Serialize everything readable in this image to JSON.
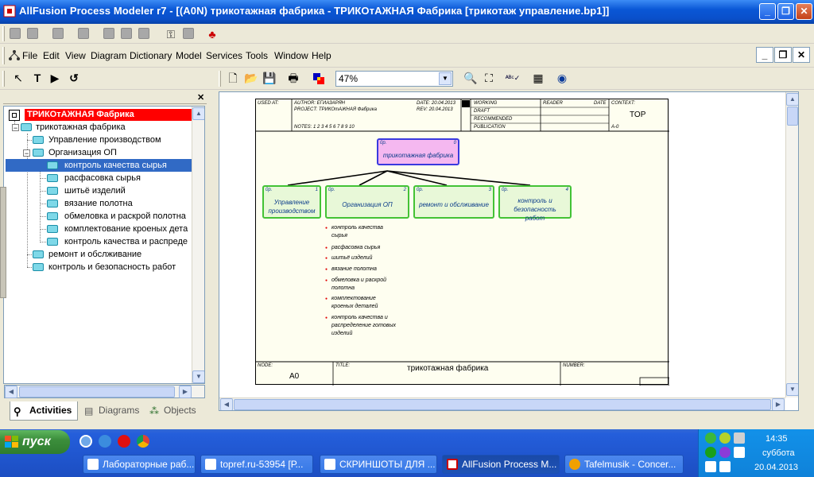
{
  "window": {
    "title": "AllFusion Process Modeler r7 - [(A0N) трикотажная фабрика - ТРИКОтАЖНАЯ Фабрика  [трикотаж управление.bp1]]",
    "minimize": "_",
    "restore": "❐",
    "close": "✕"
  },
  "menu": {
    "items": [
      "File",
      "Edit",
      "View",
      "Diagram",
      "Dictionary",
      "Model",
      "Services",
      "Tools",
      "Window",
      "Help"
    ]
  },
  "toolbar": {
    "zoom": "47%",
    "icons": [
      "new-icon",
      "open-icon",
      "save-icon",
      "print-icon",
      "color-icon",
      "zoom-in-icon",
      "zoom-fit-icon",
      "spellcheck-icon",
      "model-explorer-icon",
      "navigator-icon"
    ]
  },
  "tool_palette": {
    "icons": [
      "pointer-icon",
      "text-tool-icon",
      "arrow-tool-icon",
      "undo-icon"
    ]
  },
  "model_explorer": {
    "root": "ТРИКОтАЖНАЯ Фабрика",
    "nodes": [
      {
        "label": "трикотажная фабрика",
        "level": 1,
        "selected": false
      },
      {
        "label": "Управление производством",
        "level": 2,
        "selected": false
      },
      {
        "label": "Организация ОП",
        "level": 2,
        "selected": false
      },
      {
        "label": "контроль  качества  сырья",
        "level": 3,
        "selected": true
      },
      {
        "label": "расфасовка сырья",
        "level": 3,
        "selected": false
      },
      {
        "label": "шитьё изделий",
        "level": 3,
        "selected": false
      },
      {
        "label": "вязание  полотна",
        "level": 3,
        "selected": false
      },
      {
        "label": "обмеловка и  раскрой полотна",
        "level": 3,
        "selected": false
      },
      {
        "label": "комплектование  кроеных дета",
        "level": 3,
        "selected": false
      },
      {
        "label": "контроль качества и  распреде",
        "level": 3,
        "selected": false
      },
      {
        "label": "ремонт и обслживание",
        "level": 2,
        "selected": false
      },
      {
        "label": "контроль и  безопасность работ",
        "level": 2,
        "selected": false
      }
    ],
    "tabs": [
      "Activities",
      "Diagrams",
      "Objects"
    ]
  },
  "diagram": {
    "header": {
      "used_at": "USED AT:",
      "author": "AUTHOR:  ЕГИАЗАРЯН",
      "project": "PROJECT:  ТРИКОтАЖНАЯ Фабрика",
      "date": "DATE: 20.04.2013",
      "rev": "REV:   20.04.2013",
      "notes": "NOTES:  1  2  3  4  5  6  7  8  9  10",
      "working": "WORKING",
      "draft": "DRAFT",
      "recommended": "RECOMMENDED",
      "publication": "PUBLICATION",
      "reader": "READER",
      "date2": "DATE",
      "context": "CONTEXT:",
      "top": "TOP",
      "a0": "A-0"
    },
    "root_box": {
      "label": "трикотажная фабрика",
      "op": "0р.",
      "num": "0"
    },
    "children": [
      {
        "label": "Управление производством",
        "op": "0р.",
        "num": "1"
      },
      {
        "label": "Организация ОП",
        "op": "0р.",
        "num": "2"
      },
      {
        "label": "ремонт и обслживание",
        "op": "0р.",
        "num": "3"
      },
      {
        "label": "контроль и безопасность работ",
        "op": "0р.",
        "num": "4"
      }
    ],
    "sub_items": [
      "контроль  качества",
      "сырья",
      "расфасовка сырья",
      "шитьё изделий",
      "вязание  полотна",
      "обмеловка и  раскрой",
      "полотна",
      "комплектование",
      "кроеных деталей",
      "контроль качества и",
      "распределение готовых",
      "изделий"
    ],
    "footer": {
      "node_label": "NODE:",
      "node_value": "A0",
      "title_label": "TITLE:",
      "title_value": "трикотажная фабрика",
      "number_label": "NUMBER:"
    }
  },
  "taskbar": {
    "start": "пуск",
    "tasks": [
      {
        "label": "Лабораторные раб...",
        "active": false
      },
      {
        "label": "topref.ru-53954 [Р...",
        "active": false
      },
      {
        "label": "СКРИНШОТЫ ДЛЯ ...",
        "active": false
      },
      {
        "label": "AllFusion Process M...",
        "active": true
      },
      {
        "label": "Tafelmusik - Concer...",
        "active": false
      }
    ],
    "time": "14:35",
    "day": "суббота",
    "date": "20.04.2013"
  },
  "colors": {
    "titlebar": "#0a57d6",
    "root_node_bg": "#ff0000",
    "selected": "#316ac5",
    "root_box_bg": "#f5b8f0",
    "root_box_border": "#3a3adf",
    "child_box_border": "#43c236"
  }
}
